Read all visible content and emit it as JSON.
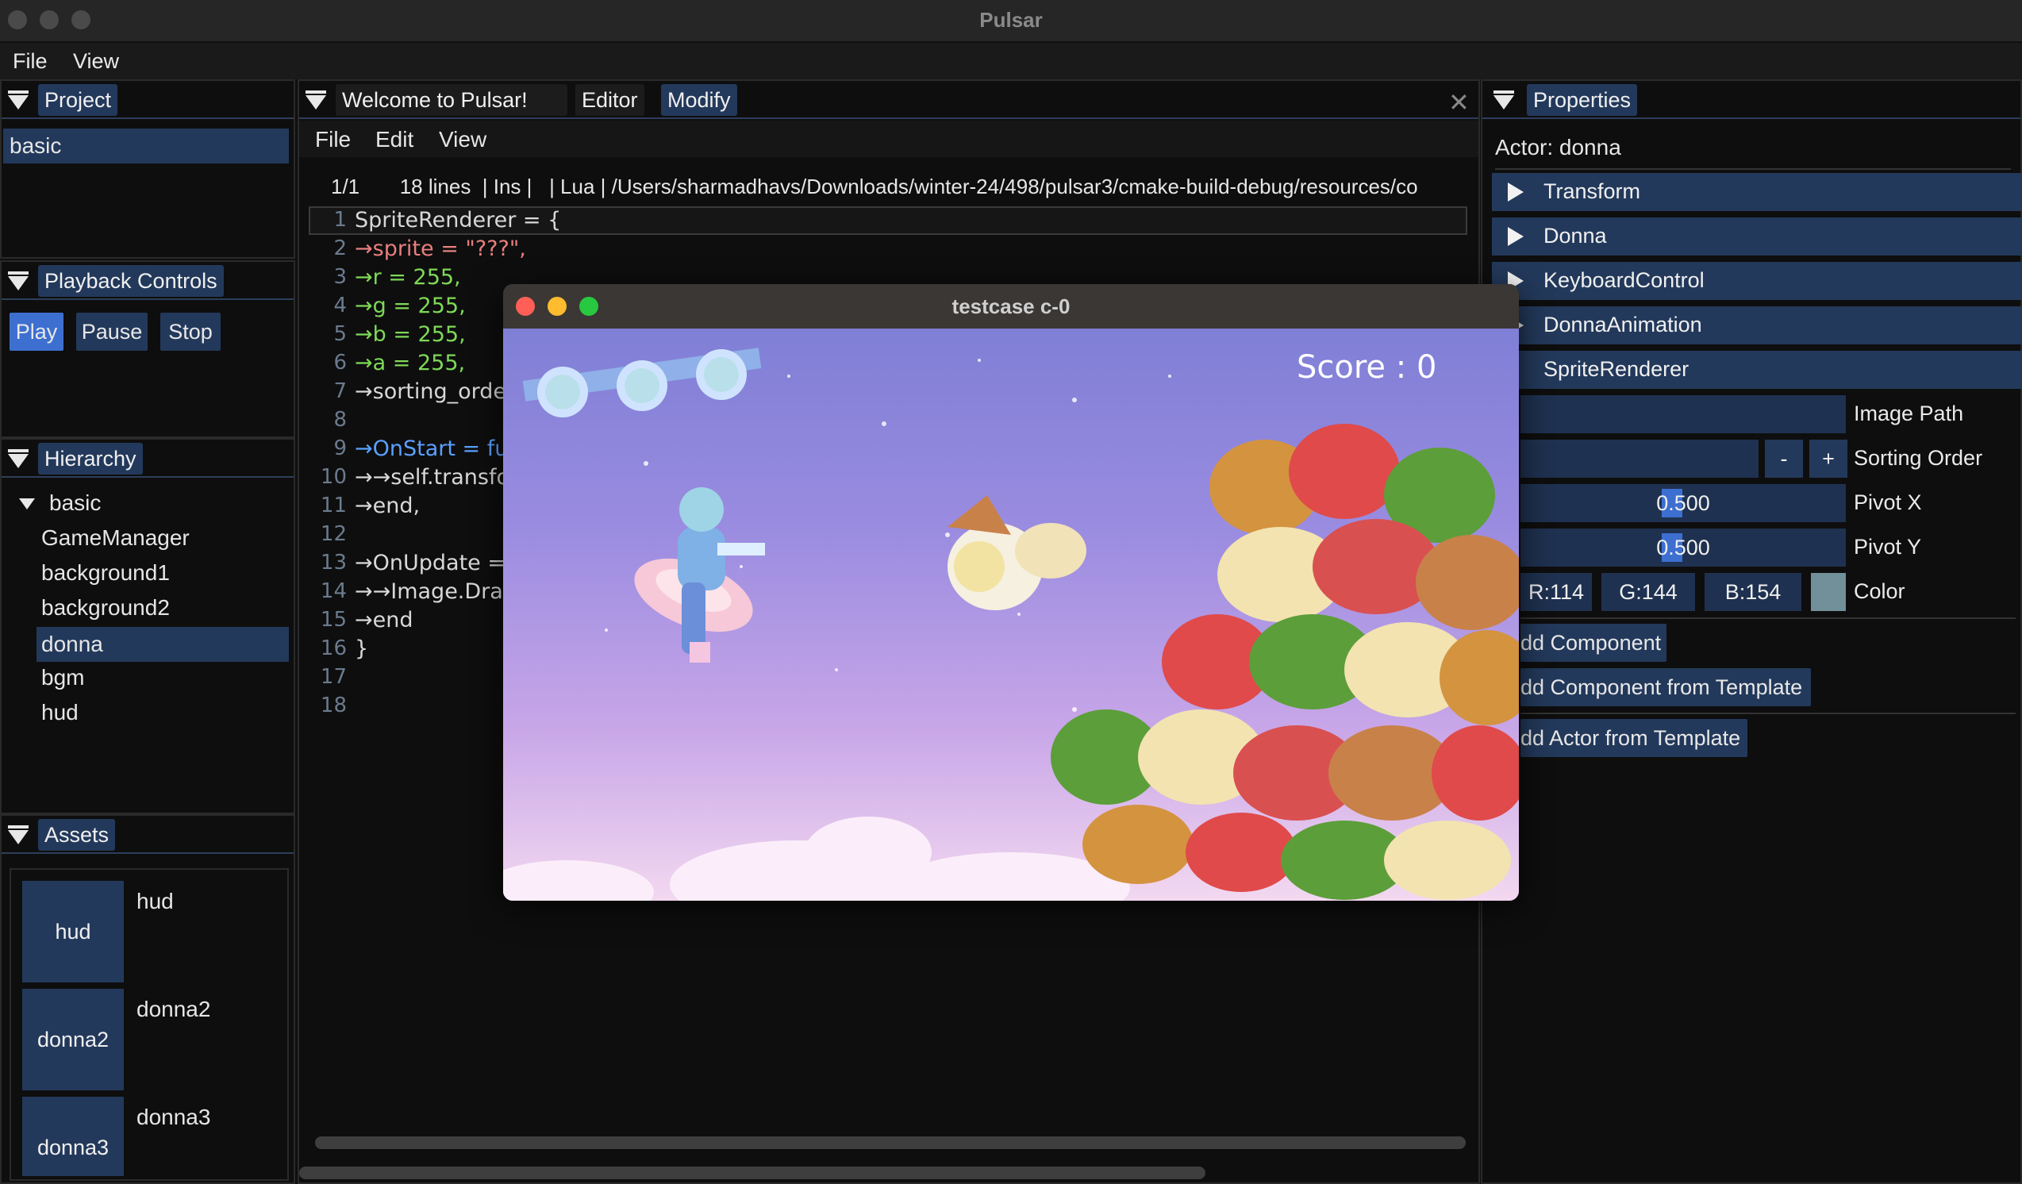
{
  "window": {
    "title": "Pulsar"
  },
  "menubar": {
    "file": "File",
    "view": "View"
  },
  "project": {
    "tab": "Project",
    "selected": "basic"
  },
  "playback": {
    "tab": "Playback Controls",
    "play": "Play",
    "pause": "Pause",
    "stop": "Stop"
  },
  "hierarchy": {
    "tab": "Hierarchy",
    "root": "basic",
    "items": [
      "GameManager",
      "background1",
      "background2",
      "donna",
      "bgm",
      "hud"
    ],
    "selected": "donna"
  },
  "assets": {
    "tab": "Assets",
    "items": [
      {
        "thumb": "hud",
        "name": "hud"
      },
      {
        "thumb": "donna2",
        "name": "donna2"
      },
      {
        "thumb": "donna3",
        "name": "donna3"
      }
    ]
  },
  "editor": {
    "tabs": [
      "Welcome to Pulsar!",
      "Editor",
      "Modify"
    ],
    "active_tab": "Modify",
    "menu": [
      "File",
      "Edit",
      "View"
    ],
    "status": "1/1       18 lines  | Ins |   | Lua | /Users/sharmadhavs/Downloads/winter-24/498/pulsar3/cmake-build-debug/resources/co",
    "lines": [
      {
        "n": "1",
        "code": "SpriteRenderer = {"
      },
      {
        "n": "2",
        "code": "→sprite = \"???\","
      },
      {
        "n": "3",
        "code": "→r = 255,"
      },
      {
        "n": "4",
        "code": "→g = 255,"
      },
      {
        "n": "5",
        "code": "→b = 255,"
      },
      {
        "n": "6",
        "code": "→a = 255,"
      },
      {
        "n": "7",
        "code": "→sorting_order"
      },
      {
        "n": "8",
        "code": ""
      },
      {
        "n": "9",
        "code": "→OnStart = fun"
      },
      {
        "n": "10",
        "code": "→→self.transfor"
      },
      {
        "n": "11",
        "code": "→end,"
      },
      {
        "n": "12",
        "code": ""
      },
      {
        "n": "13",
        "code": "→OnUpdate = f"
      },
      {
        "n": "14",
        "code": "→→Image.Draw"
      },
      {
        "n": "15",
        "code": "→end"
      },
      {
        "n": "16",
        "code": "}"
      },
      {
        "n": "17",
        "code": ""
      },
      {
        "n": "18",
        "code": ""
      }
    ]
  },
  "properties": {
    "tab": "Properties",
    "actor": "Actor: donna",
    "components": [
      "Transform",
      "Donna",
      "KeyboardControl",
      "DonnaAnimation",
      "SpriteRenderer"
    ],
    "image_path_label": "Image Path",
    "sorting_order_label": "Sorting Order",
    "minus": "-",
    "plus": "+",
    "pivot_x_label": "Pivot X",
    "pivot_x": "0.500",
    "pivot_y_label": "Pivot Y",
    "pivot_y": "0.500",
    "r": "R:114",
    "g": "G:144",
    "b": "B:154",
    "color_label": "Color",
    "color_swatch": "#72909a",
    "add_component": "dd Component",
    "add_component_template": "dd Component from Template",
    "add_actor_template": "dd Actor from Template"
  },
  "game_window": {
    "title": "testcase c-0",
    "score": "Score : 0"
  }
}
